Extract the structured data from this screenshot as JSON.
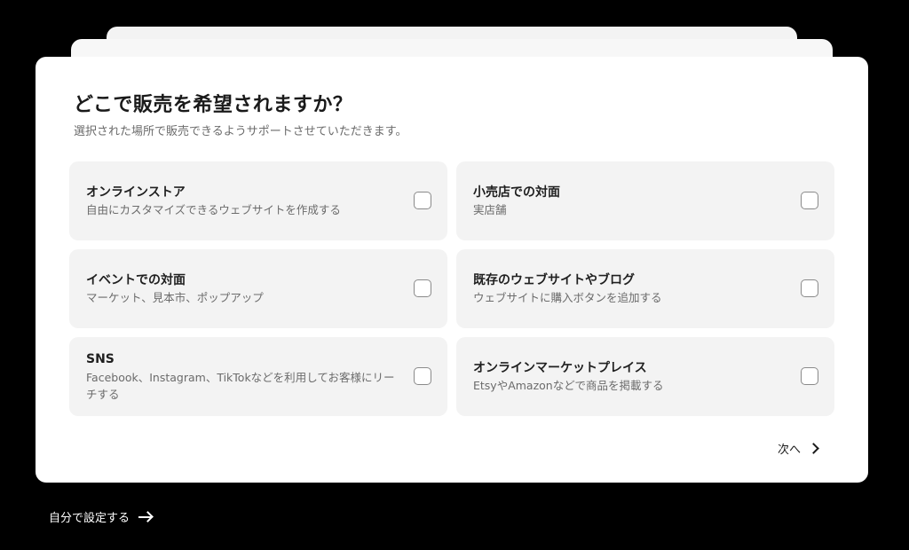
{
  "dialog": {
    "title": "どこで販売を希望されますか？",
    "subtitle": "選択された場所で販売できるようサポートさせていただきます。"
  },
  "options": [
    {
      "title": "オンラインストア",
      "description": "自由にカスタマイズできるウェブサイトを作成する",
      "checked": false
    },
    {
      "title": "小売店での対面",
      "description": "実店舗",
      "checked": false
    },
    {
      "title": "イベントでの対面",
      "description": "マーケット、見本市、ポップアップ",
      "checked": false
    },
    {
      "title": "既存のウェブサイトやブログ",
      "description": "ウェブサイトに購入ボタンを追加する",
      "checked": false
    },
    {
      "title": "SNS",
      "description": "Facebook、Instagram、TikTokなどを利用してお客様にリーチする",
      "checked": false
    },
    {
      "title": "オンラインマーケットプレイス",
      "description": "EtsyやAmazonなどで商品を掲載する",
      "checked": false
    }
  ],
  "footer": {
    "next_label": "次へ",
    "self_setup_label": "自分で設定する"
  },
  "colors": {
    "background": "#000000",
    "card": "#ffffff",
    "option_bg": "#f3f3f3",
    "text_primary": "#1a1a1a",
    "text_secondary": "#6b6b6b"
  }
}
